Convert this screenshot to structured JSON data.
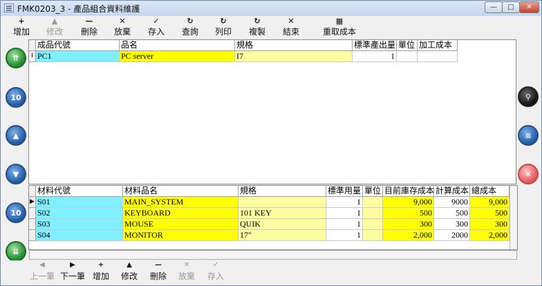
{
  "window": {
    "title": "FMK0203_3 - 產品組合資料維護"
  },
  "toolbar": [
    {
      "glyph": "+",
      "label": "增加",
      "disabled": false
    },
    {
      "glyph": "▲",
      "label": "修改",
      "disabled": true
    },
    {
      "glyph": "—",
      "label": "刪除",
      "disabled": false
    },
    {
      "glyph": "✕",
      "label": "放棄",
      "disabled": false
    },
    {
      "glyph": "✓",
      "label": "存入",
      "disabled": false
    },
    {
      "glyph": "↻",
      "label": "查詢",
      "disabled": false
    },
    {
      "glyph": "↻",
      "label": "列印",
      "disabled": false
    },
    {
      "glyph": "↻",
      "label": "複製",
      "disabled": false
    },
    {
      "glyph": "✕",
      "label": "結束",
      "disabled": false
    },
    {
      "glyph": "▦",
      "label": "重取成本",
      "disabled": false
    }
  ],
  "side_left": [
    {
      "icon": "first-record-icon",
      "text": "⇈",
      "style": "green"
    },
    {
      "icon": "up-ten-icon",
      "text": "10",
      "style": "blue"
    },
    {
      "icon": "up-icon",
      "text": "▲",
      "style": "blue"
    },
    {
      "icon": "down-icon",
      "text": "▼",
      "style": "blue"
    },
    {
      "icon": "down-ten-icon",
      "text": "10",
      "style": "blue"
    },
    {
      "icon": "last-record-icon",
      "text": "⇊",
      "style": "green"
    }
  ],
  "side_right": [
    {
      "icon": "search-icon",
      "text": "⚲",
      "style": "dark"
    },
    {
      "icon": "list-icon",
      "text": "≡",
      "style": "blue"
    },
    {
      "icon": "cancel-icon",
      "text": "✕",
      "style": "red"
    }
  ],
  "product_grid": {
    "headers": [
      "成品代號",
      "品名",
      "規格",
      "標準產出量",
      "單位",
      "加工成本"
    ],
    "rows": [
      {
        "indicator": "I",
        "code": "PC1",
        "name": "PC server",
        "spec": "I7",
        "qty": "1",
        "unit": "",
        "cost": ""
      }
    ]
  },
  "material_grid": {
    "headers": [
      "材料代號",
      "材料品名",
      "規格",
      "標準用量",
      "單位",
      "目前庫存成本",
      "計算成本",
      "總成本"
    ],
    "rows": [
      {
        "indicator": "▶",
        "code": "S01",
        "name": "MAIN_SYSTEM",
        "spec": "",
        "qty": "1",
        "unit": "",
        "stock": "9,000",
        "calc": "9000",
        "total": "9,000"
      },
      {
        "indicator": "",
        "code": "S02",
        "name": "KEYBOARD",
        "spec": "101 KEY",
        "qty": "1",
        "unit": "",
        "stock": "500",
        "calc": "500",
        "total": "500"
      },
      {
        "indicator": "",
        "code": "S03",
        "name": "MOUSE",
        "spec": "QUIK",
        "qty": "1",
        "unit": "",
        "stock": "300",
        "calc": "300",
        "total": "300"
      },
      {
        "indicator": "",
        "code": "S04",
        "name": "MONITOR",
        "spec": "17\"",
        "qty": "1",
        "unit": "",
        "stock": "2,000",
        "calc": "2000",
        "total": "2,000"
      }
    ]
  },
  "bottom_toolbar": [
    {
      "glyph": "◀",
      "label": "上一筆",
      "disabled": true
    },
    {
      "glyph": "▶",
      "label": "下一筆",
      "disabled": false
    },
    {
      "glyph": "+",
      "label": "增加",
      "disabled": false
    },
    {
      "glyph": "▲",
      "label": "修改",
      "disabled": false
    },
    {
      "glyph": "—",
      "label": "刪除",
      "disabled": false
    },
    {
      "glyph": "✕",
      "label": "放棄",
      "disabled": true
    },
    {
      "glyph": "✓",
      "label": "存入",
      "disabled": true
    }
  ],
  "colors": {
    "code_bg": "#7ff0ff",
    "name_bg": "#ffff00",
    "spec_bg": "#ffffa0"
  }
}
